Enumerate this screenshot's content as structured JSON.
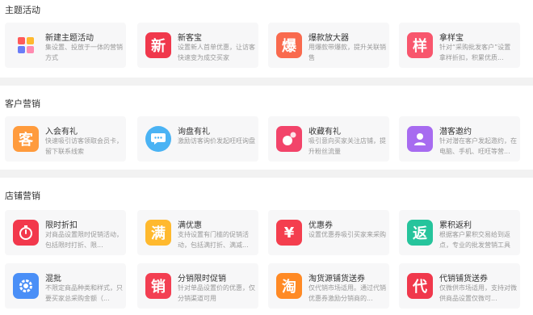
{
  "sections": [
    {
      "title": "主题活动",
      "cards": [
        {
          "title": "新建主题活动",
          "desc": "集设置、投放于一体的营销方式",
          "icon": "four-squares-icon",
          "glyph": "",
          "color": "#ffffff"
        },
        {
          "title": "新客宝",
          "desc": "设置新人首单优惠，让访客快速变为成交买家",
          "icon": "xin-icon",
          "glyph": "新",
          "color": "#f0384c"
        },
        {
          "title": "爆款放大器",
          "desc": "用爆款带爆款，提升关联销售",
          "icon": "bao-icon",
          "glyph": "爆",
          "color": "#f96a4e"
        },
        {
          "title": "拿样宝",
          "desc": "针对“采购批发客户”设置拿样折扣，积累优质...",
          "icon": "yang-icon",
          "glyph": "样",
          "color": "#f8566d"
        }
      ]
    },
    {
      "title": "客户营销",
      "cards": [
        {
          "title": "入会有礼",
          "desc": "快速吸引访客领取会员卡，留下联系线索",
          "icon": "ke-icon",
          "glyph": "客",
          "color": "#ff9b3d"
        },
        {
          "title": "询盘有礼",
          "desc": "激励访客询价发起旺旺询盘",
          "icon": "chat-bubble-icon",
          "glyph": "",
          "color": "#4ab3f4"
        },
        {
          "title": "收藏有礼",
          "desc": "吸引意向买家关注店铺，提升粉丝流量",
          "icon": "favorite-circles-icon",
          "glyph": "",
          "color": "#f2446a"
        },
        {
          "title": "潜客邀约",
          "desc": "针对潜在客户发起邀约，在电脑、手机、旺旺等营...",
          "icon": "user-icon",
          "glyph": "",
          "color": "#a76bf0"
        }
      ]
    },
    {
      "title": "店铺营销",
      "cards": [
        {
          "title": "限时折扣",
          "desc": "对商品设置限时促销活动，包括限时打折、限...",
          "icon": "stopwatch-icon",
          "glyph": "",
          "color": "#f2384c"
        },
        {
          "title": "满优惠",
          "desc": "支持设置有门槛的促销活动，包括满打折、满减...",
          "icon": "man-icon",
          "glyph": "满",
          "color": "#ffb92e"
        },
        {
          "title": "优惠券",
          "desc": "设置优惠券吸引买家来采购",
          "icon": "yen-icon",
          "glyph": "¥",
          "color": "#f43e4e"
        },
        {
          "title": "累积返利",
          "desc": "根据客户累积交易给到返点，专业的批发营销工具",
          "icon": "fan-icon",
          "glyph": "返",
          "color": "#26c49c"
        },
        {
          "title": "混批",
          "desc": "不限定商品种类和样式，只要买家总采购金额（...",
          "icon": "gear-icon",
          "glyph": "",
          "color": "#4a8ff7"
        },
        {
          "title": "分销限时促销",
          "desc": "针对单品设置价的优惠，仅分销渠道可用",
          "icon": "xiao-icon",
          "glyph": "销",
          "color": "#f33f52"
        },
        {
          "title": "淘货源铺货送券",
          "desc": "仅代销市场适用。通过代销优惠券激励分销商的...",
          "icon": "tao-icon",
          "glyph": "淘",
          "color": "#ff8a25"
        },
        {
          "title": "代销铺货送券",
          "desc": "仅微供市场适用，支持对微供商品设置仅微可...",
          "icon": "dai-icon",
          "glyph": "代",
          "color": "#f0384c"
        }
      ]
    }
  ]
}
